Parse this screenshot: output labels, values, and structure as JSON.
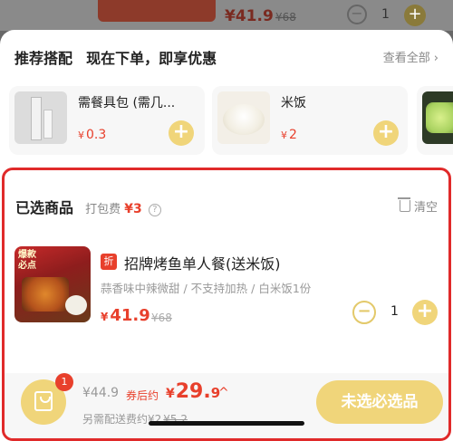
{
  "background_row": {
    "price": "¥41.9",
    "old_price": "¥68",
    "quantity": "1",
    "minus": "−",
    "plus": "+"
  },
  "recommend": {
    "title": "推荐搭配",
    "subtitle": "现在下单，即享优惠",
    "view_all": "查看全部",
    "view_all_chevron": "›",
    "items": [
      {
        "name": "需餐具包 (需几...",
        "price": "0.3",
        "currency": "¥",
        "icon": "utensil-pack-image"
      },
      {
        "name": "米饭",
        "price": "2",
        "currency": "¥",
        "icon": "rice-bowl-image"
      },
      {
        "name": "",
        "price": "",
        "currency": "",
        "icon": "vegetable-dish-image"
      }
    ],
    "add_symbol": "+"
  },
  "selected": {
    "title": "已选商品",
    "packing_fee_label": "打包费",
    "packing_fee_amount": "¥3",
    "info_symbol": "?",
    "clear_label": "清空",
    "item": {
      "promo_tag": "爆款 必点",
      "discount_badge": "折",
      "name": "招牌烤鱼单人餐(送米饭)",
      "description": "蒜香味中辣微甜 / 不支持加热 / 白米饭1份",
      "currency": "¥",
      "price": "41.9",
      "old_price": "¥68",
      "quantity": "1",
      "minus": "−",
      "plus": "+"
    }
  },
  "bottom_bar": {
    "cart_count": "1",
    "original_total": "¥44.9",
    "after_coupon_label": "券后约",
    "final_currency": "¥",
    "final_total_main": "29.",
    "final_total_decimal": "9",
    "expand_chevron": "^",
    "delivery_label": "另需配送费约",
    "delivery_fee": "¥2",
    "delivery_old_fee": "¥5.2",
    "submit_label": "未选必选品"
  },
  "colors": {
    "accent_red": "#e8402c",
    "highlight_border": "#e02a2a",
    "button_yellow": "#f0d57a"
  }
}
